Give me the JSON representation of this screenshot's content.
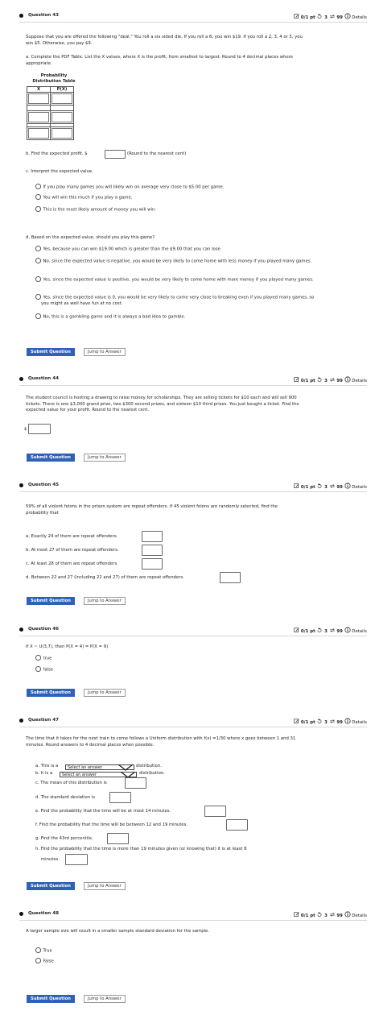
{
  "common": {
    "points": "0/1 pt",
    "attempts": "3",
    "tries": "99",
    "details": "Details",
    "submit": "Submit Question",
    "jump": "Jump to Answer",
    "select_placeholder": "Select an answer"
  },
  "q43": {
    "title": "Question 43",
    "intro": "Suppose that you are offered the following \"deal.\" You roll a six sided die. If you roll a 6, you win $19. If you roll a 2, 3, 4 or 5, you win $5. Otherwise, you pay $9.",
    "part_a": "a. Complete the PDF Table. List the X values, where X is the profit, from smallest to largest. Round to 4 decimal places where appropriate.",
    "table_title_1": "Probability",
    "table_title_2": "Distribution Table",
    "col_x": "X",
    "col_px": "P(X)",
    "part_b": "b. Find the expected profit. $",
    "part_b_note": "(Round to the nearest cent)",
    "part_c": "c. Interpret the expected value.",
    "c_options": [
      "If you play many games you will likely win on average very close to $5.00 per game.",
      "You will win this much if you play a game.",
      "This is the most likely amount of money you will win."
    ],
    "part_d": "d. Based on the expected value, should you play this game?",
    "d_options": [
      "Yes, because you can win $19.00 which is greater than the $9.00 that you can lose.",
      "No, since the expected value is negative, you would be very likely to come home with less money if you played many games.",
      "Yes, since the expected value is positive, you would be very likely to come home with more money if you played many games.",
      "Yes, since the expected value is 0, you would be very likely to come very close to breaking even if you played many games, so you might as well have fun at no cost.",
      "No, this is a gambling game and it is always a bad idea to gamble."
    ]
  },
  "q44": {
    "title": "Question 44",
    "text": "The student council is hosting a drawing to raise money for scholarships. They are selling tickets for $10 each and will sell 900 tickets. There is one $3,000 grand prize, two $300 second prizes, and sixteen $10 third prizes. You just bought a ticket. Find the expected value for your profit. Round to the nearest cent.",
    "dollar": "$"
  },
  "q45": {
    "title": "Question 45",
    "text": "59% of all violent felons in the prison system are repeat offenders. If 45 violent felons are randomly selected, find the probability that",
    "parts": [
      "a. Exactly 24 of them are repeat offenders.",
      "b. At most 27 of them are repeat offenders.",
      "c. At least 28 of them are repeat offenders.",
      "d. Between 22 and 27 (including 22 and 27) of them are repeat offenders."
    ]
  },
  "q46": {
    "title": "Question 46",
    "text": "If X ~ U(3,7), then P(X = 4) = P(X = 9)",
    "options": [
      "true",
      "false"
    ]
  },
  "q47": {
    "title": "Question 47",
    "text": "The time that it takes for the next train to come follows a Uniform distribution with f(x) =1/30 where x goes between 1 and 31 minutes. Round answers to 4 decimal places when possible.",
    "part_a": "a. This is a",
    "part_b": "b. It is a",
    "dist": "distribution.",
    "part_c": "c. The mean of this distribution is",
    "part_d": "d. The standard deviation is",
    "part_e": "e. Find the probability that the time will be at most 14 minutes.",
    "part_f": "f. Find the probability that the time will be between 12 and 19 minutes.",
    "part_g": "g. Find the 43rd percentile.",
    "part_h_1": "h. Find the probability that the time is more than 19 minutes given (or knowing that) it is at least 8",
    "part_h_2": "minutes."
  },
  "q48": {
    "title": "Question 48",
    "text": "A larger sample size will result in a smaller sample standard deviation for the sample.",
    "options": [
      "True",
      "False"
    ]
  }
}
